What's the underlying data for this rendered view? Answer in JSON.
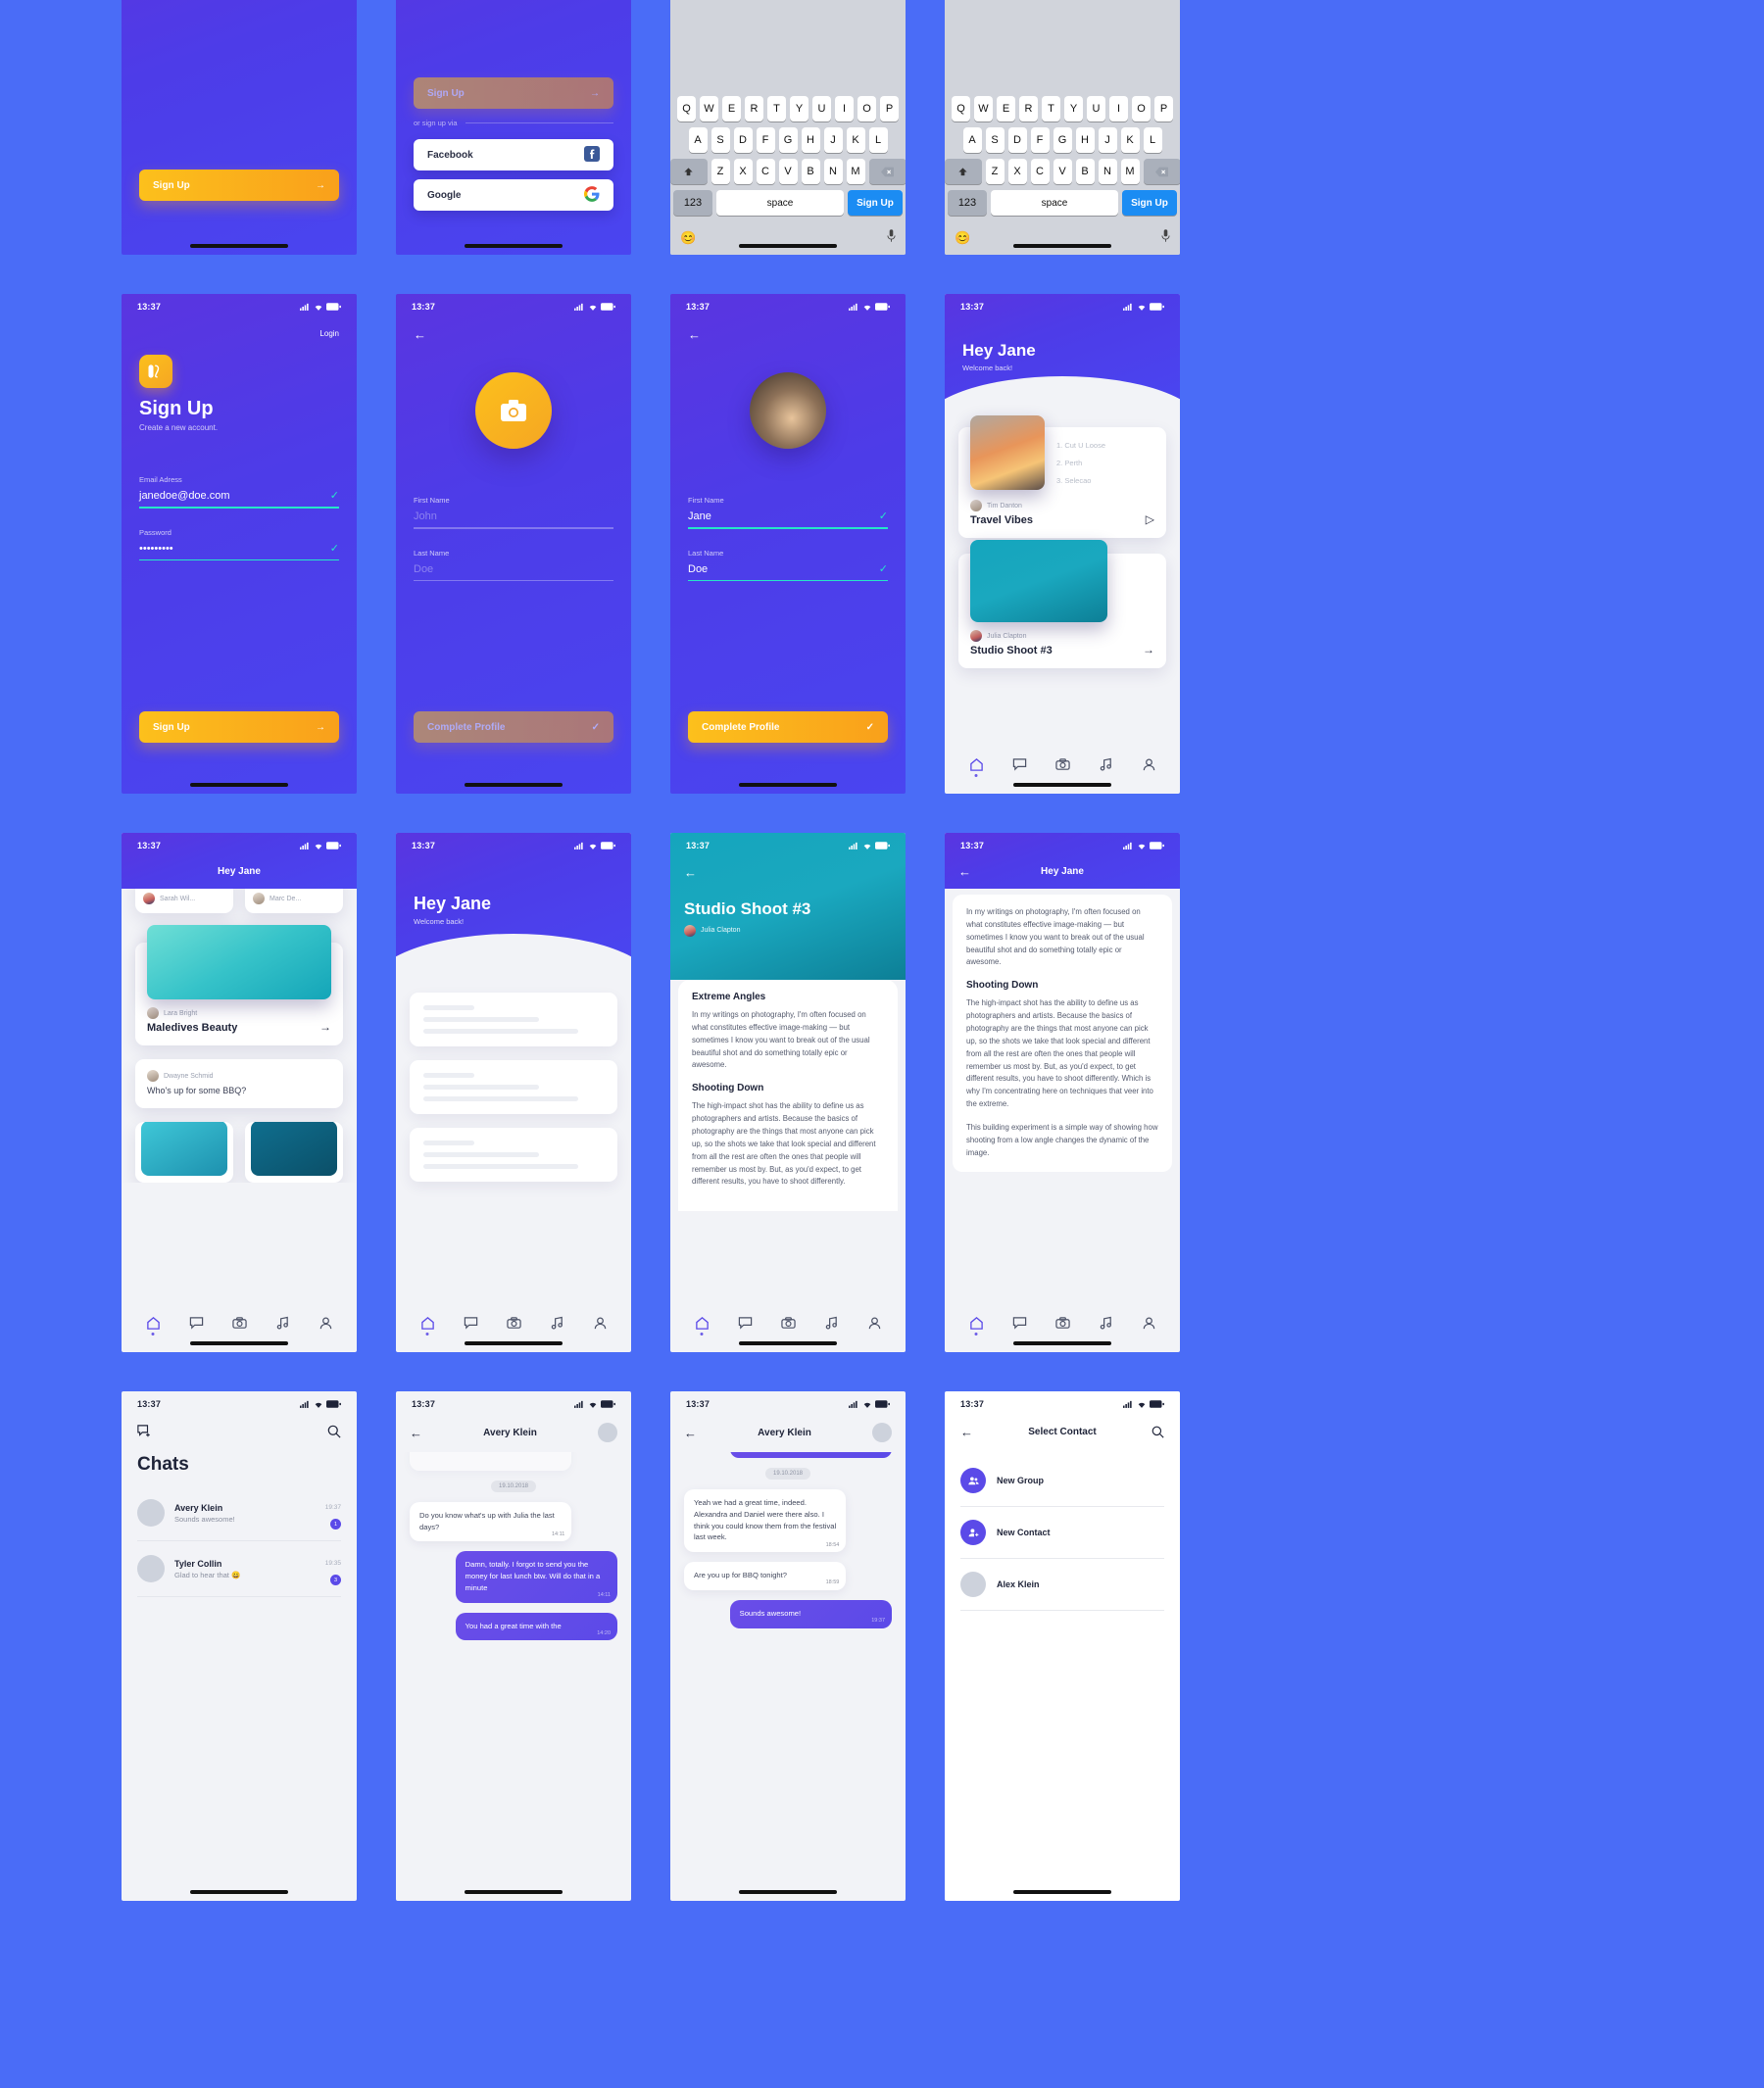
{
  "meta": {
    "background_color": "#4a6cf7",
    "accent_purple": "#5b4ae8",
    "accent_yellow": "#f9a01b",
    "accent_teal": "#25e6c8",
    "status_time": "13:37"
  },
  "screens": {
    "signup_social": {
      "sign_up_button": "Sign Up",
      "divider": "or sign up via",
      "facebook": "Facebook",
      "google": "Google"
    },
    "keyboard": {
      "row1": [
        "Q",
        "W",
        "E",
        "R",
        "T",
        "Y",
        "U",
        "I",
        "O",
        "P"
      ],
      "row2": [
        "A",
        "S",
        "D",
        "F",
        "G",
        "H",
        "J",
        "K",
        "L"
      ],
      "row3": [
        "Z",
        "X",
        "C",
        "V",
        "B",
        "N",
        "M"
      ],
      "numeric_key": "123",
      "space_key": "space",
      "action_key": "Sign Up",
      "shift_icon": "shift-icon",
      "backspace_icon": "backspace-icon",
      "emoji_icon": "emoji-icon",
      "mic_icon": "microphone-icon"
    },
    "signup": {
      "login_link": "Login",
      "title": "Sign Up",
      "subtitle": "Create a new account.",
      "email_label": "Email Adress",
      "email_value": "janedoe@doe.com",
      "password_label": "Password",
      "password_value": "•••••••••",
      "submit": "Sign Up"
    },
    "profile_empty": {
      "back_icon": "back-arrow-icon",
      "camera_icon": "camera-icon",
      "first_name_label": "First Name",
      "first_name_placeholder": "John",
      "last_name_label": "Last Name",
      "last_name_placeholder": "Doe",
      "submit": "Complete Profile"
    },
    "profile_filled": {
      "back_icon": "back-arrow-icon",
      "first_name_label": "First Name",
      "first_name_value": "Jane",
      "last_name_label": "Last Name",
      "last_name_value": "Doe",
      "submit": "Complete Profile"
    },
    "home": {
      "greeting": "Hey Jane",
      "welcome": "Welcome back!",
      "cards": [
        {
          "author": "Tim Danton",
          "title": "Travel Vibes",
          "tracks": [
            "1. Cut U Loose",
            "2. Perth",
            "3. Selecao"
          ],
          "action_icon": "play-icon"
        },
        {
          "author": "Julia Clapton",
          "title": "Studio Shoot #3",
          "action_icon": "arrow-right-icon"
        }
      ],
      "tabs": [
        "home-icon",
        "chat-icon",
        "camera-icon",
        "music-icon",
        "profile-icon"
      ]
    },
    "feed": {
      "header": "Hey Jane",
      "cards": [
        {
          "author": "Sarah Wil...",
          "title": ""
        },
        {
          "author": "Marc De...",
          "title": ""
        },
        {
          "author": "Lara Bright",
          "title": "Maledives Beauty",
          "action_icon": "arrow-right-icon"
        },
        {
          "author": "Dwayne Schmid",
          "title": "Who's up for some BBQ?"
        }
      ]
    },
    "feed_loading": {
      "greeting": "Hey Jane",
      "welcome": "Welcome back!"
    },
    "article": {
      "back_icon": "back-arrow-icon",
      "hero_title": "Studio Shoot #3",
      "hero_author": "Julia Clapton",
      "sections": [
        {
          "heading": "Extreme Angles",
          "body": "In my writings on photography, I'm often focused on what constitutes effective image-making — but sometimes I know you want to break out of the usual beautiful shot and do something totally epic or awesome."
        },
        {
          "heading": "Shooting Down",
          "body": "The high-impact shot has the ability to define us as photographers and artists. Because the basics of photography are the things that most anyone can pick up, so the shots we take that look special and different from all the rest are often the ones that people will remember us most by. But, as you'd expect, to get different results, you have to shoot differently."
        }
      ]
    },
    "article_scrolled": {
      "back_icon": "back-arrow-icon",
      "header": "Hey Jane",
      "intro": "In my writings on photography, I'm often focused on what constitutes effective image-making — but sometimes I know you want to break out of the usual beautiful shot and do something totally epic or awesome.",
      "sections": [
        {
          "heading": "Shooting Down",
          "body": "The high-impact shot has the ability to define us as photographers and artists. Because the basics of photography are the things that most anyone can pick up, so the shots we take that look special and different from all the rest are often the ones that people will remember us most by. But, as you'd expect, to get different results, you have to shoot differently. Which is why I'm concentrating here on techniques that veer into the extreme."
        }
      ],
      "closing": "This building experiment is a simple way of showing how shooting from a low angle changes the dynamic of the image."
    },
    "chats": {
      "compose_icon": "new-chat-icon",
      "search_icon": "search-icon",
      "title": "Chats",
      "items": [
        {
          "name": "Avery Klein",
          "message": "Sounds awesome!",
          "time": "19:37",
          "unread": "1"
        },
        {
          "name": "Tyler Collin",
          "message": "Glad to hear that 😀",
          "time": "19:35",
          "unread": "3"
        }
      ]
    },
    "conversation_a": {
      "back_icon": "back-arrow-icon",
      "title": "Avery Klein",
      "day_label": "19.10.2018",
      "messages": [
        {
          "dir": "in",
          "text": "Do you know what's up with Julia the last days?",
          "time": "14:11"
        },
        {
          "dir": "out",
          "text": "Damn, totally. I forgot to send you the money for last lunch btw. Will do that in a minute",
          "time": "14:11"
        },
        {
          "dir": "out",
          "text": "You had a great time with the",
          "time": "14:20"
        }
      ]
    },
    "conversation_b": {
      "back_icon": "back-arrow-icon",
      "title": "Avery Klein",
      "day_label": "19.10.2018",
      "messages": [
        {
          "dir": "in",
          "text": "Yeah we had a great time, indeed. Alexandra and Daniel were there also. I think you could know them from the festival last week.",
          "time": "18:54"
        },
        {
          "dir": "in",
          "text": "Are you up for BBQ tonight?",
          "time": "18:59"
        },
        {
          "dir": "out",
          "text": "Sounds awesome!",
          "time": "19:37"
        }
      ]
    },
    "select_contact": {
      "back_icon": "back-arrow-icon",
      "title": "Select Contact",
      "search_icon": "search-icon",
      "items": [
        {
          "label": "New Group",
          "icon": "group-icon"
        },
        {
          "label": "New Contact",
          "icon": "add-person-icon"
        },
        {
          "label": "Alex Klein",
          "icon": "avatar"
        }
      ]
    }
  }
}
